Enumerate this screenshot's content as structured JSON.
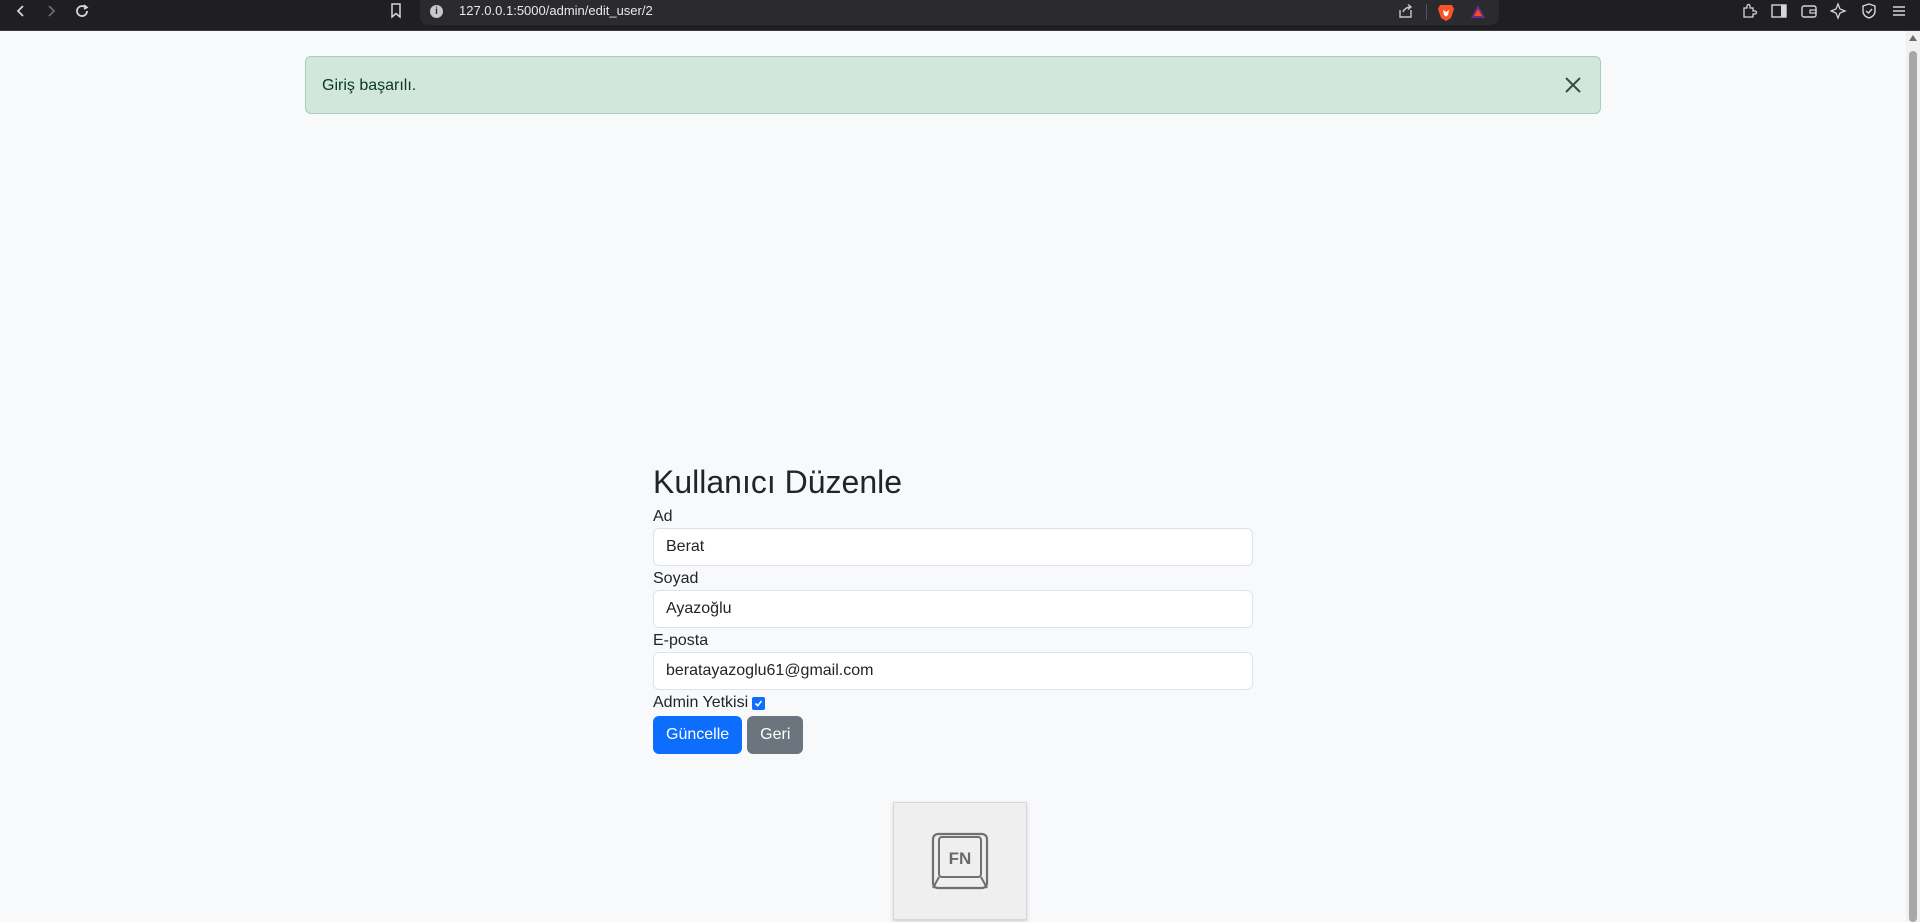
{
  "browser": {
    "url": "127.0.0.1:5000/admin/edit_user/2"
  },
  "alert": {
    "message": "Giriş başarılı."
  },
  "form": {
    "title": "Kullanıcı Düzenle",
    "first_name_label": "Ad",
    "first_name_value": "Berat",
    "last_name_label": "Soyad",
    "last_name_value": "Ayazoğlu",
    "email_label": "E-posta",
    "email_value": "beratayazoglu61@gmail.com",
    "admin_label": "Admin Yetkisi",
    "admin_checked": true,
    "update_button": "Güncelle",
    "back_button": "Geri"
  },
  "widget": {
    "key_label": "FN"
  },
  "colors": {
    "primary": "#0d6efd",
    "secondary": "#6c757d",
    "alert_bg": "#d1e7dd",
    "alert_text": "#0a3622"
  }
}
